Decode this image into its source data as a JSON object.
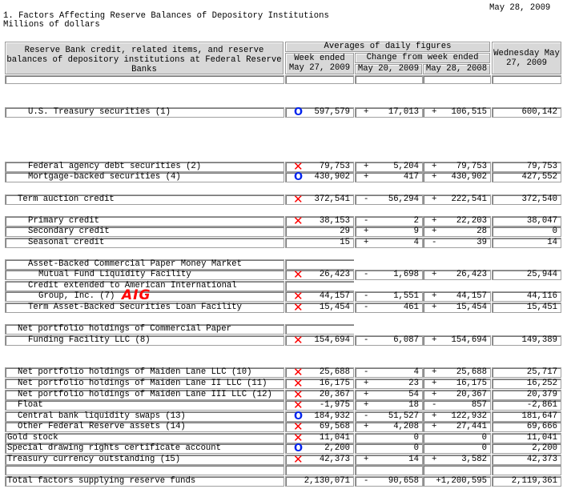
{
  "date": "May 28, 2009",
  "title": "1. Factors Affecting Reserve Balances of Depository Institutions",
  "subtitle": "Millions of dollars",
  "header": {
    "label_col": "Reserve Bank credit, related items, and\nreserve balances of depository institutions at\nFederal Reserve Banks",
    "averages": "Averages of daily figures",
    "week_ended": "Week ended\nMay 27, 2009",
    "change_from": "Change from week ended",
    "change1": "May 20, 2009",
    "change2": "May 28, 2008",
    "wednesday": "Wednesday\nMay 27, 2009"
  },
  "annotation_text": "AIG",
  "colors": {
    "x_mark": "#ff0000",
    "o_mark": "#0022ee",
    "header_bg": "#d8d8d8"
  },
  "rows": [
    {
      "label": "U.S. Treasury securities (1)",
      "indent": 2,
      "mark": "circle",
      "week": "597,579",
      "s1": "+",
      "c1": "17,013",
      "s2": "+",
      "c2": "106,515",
      "wed": "600,142"
    },
    {
      "label": "Federal agency debt securities (2)",
      "indent": 2,
      "mark": "x",
      "week": "79,753",
      "s1": "+",
      "c1": "5,204",
      "s2": "+",
      "c2": "79,753",
      "wed": "79,753"
    },
    {
      "label": "Mortgage-backed securities (4)",
      "indent": 2,
      "mark": "circle",
      "week": "430,902",
      "s1": "+",
      "c1": "417",
      "s2": "+",
      "c2": "430,902",
      "wed": "427,552"
    },
    {
      "label": "Term auction credit",
      "indent": 1,
      "mark": "x",
      "week": "372,541",
      "s1": "-",
      "c1": "56,294",
      "s2": "+",
      "c2": "222,541",
      "wed": "372,540"
    },
    {
      "label": "Primary credit",
      "indent": 2,
      "mark": "x",
      "week": "38,153",
      "s1": "-",
      "c1": "2",
      "s2": "+",
      "c2": "22,203",
      "wed": "38,047"
    },
    {
      "label": "Secondary credit",
      "indent": 2,
      "mark": "",
      "week": "29",
      "s1": "+",
      "c1": "9",
      "s2": "+",
      "c2": "28",
      "wed": "0"
    },
    {
      "label": "Seasonal credit",
      "indent": 2,
      "mark": "",
      "week": "15",
      "s1": "+",
      "c1": "4",
      "s2": "-",
      "c2": "39",
      "wed": "14"
    },
    {
      "label": "Asset-Backed Commercial Paper Money Market",
      "indent": 2,
      "labelonly": true
    },
    {
      "label": "Mutual Fund Liquidity Facility",
      "indent": 3,
      "mark": "x",
      "week": "26,423",
      "s1": "-",
      "c1": "1,698",
      "s2": "+",
      "c2": "26,423",
      "wed": "25,944"
    },
    {
      "label": "Credit extended to American International",
      "indent": 2,
      "labelonly": true
    },
    {
      "label": "Group, Inc. (7)",
      "indent": 3,
      "mark": "x",
      "week": "44,157",
      "s1": "-",
      "c1": "1,551",
      "s2": "+",
      "c2": "44,157",
      "wed": "44,116"
    },
    {
      "label": "Term Asset-Backed Securities Loan Facility",
      "indent": 2,
      "mark": "x",
      "week": "15,454",
      "s1": "-",
      "c1": "461",
      "s2": "+",
      "c2": "15,454",
      "wed": "15,451"
    },
    {
      "label": "Net portfolio holdings of Commercial Paper",
      "indent": 1,
      "labelonly": true
    },
    {
      "label": "Funding Facility LLC (8)",
      "indent": 2,
      "mark": "x",
      "week": "154,694",
      "s1": "-",
      "c1": "6,087",
      "s2": "+",
      "c2": "154,694",
      "wed": "149,389"
    },
    {
      "label": "Net portfolio holdings of Maiden Lane LLC (10)",
      "indent": 1,
      "mark": "x",
      "week": "25,688",
      "s1": "-",
      "c1": "4",
      "s2": "+",
      "c2": "25,688",
      "wed": "25,717"
    },
    {
      "label": "Net portfolio holdings of Maiden Lane II LLC (11)",
      "indent": 1,
      "mark": "x",
      "week": "16,175",
      "s1": "+",
      "c1": "23",
      "s2": "+",
      "c2": "16,175",
      "wed": "16,252"
    },
    {
      "label": "Net portfolio holdings of Maiden Lane III LLC (12)",
      "indent": 1,
      "mark": "x",
      "week": "20,367",
      "s1": "+",
      "c1": "54",
      "s2": "+",
      "c2": "20,367",
      "wed": "20,379"
    },
    {
      "label": "Float",
      "indent": 1,
      "mark": "x",
      "week": "-1,975",
      "s1": "+",
      "c1": "18",
      "s2": "-",
      "c2": "857",
      "wed": "-2,861"
    },
    {
      "label": "Central bank liquidity swaps (13)",
      "indent": 1,
      "mark": "circle",
      "week": "184,932",
      "s1": "-",
      "c1": "51,527",
      "s2": "+",
      "c2": "122,932",
      "wed": "181,647"
    },
    {
      "label": "Other Federal Reserve assets (14)",
      "indent": 1,
      "mark": "x",
      "week": "69,568",
      "s1": "+",
      "c1": "4,208",
      "s2": "+",
      "c2": "27,441",
      "wed": "69,666"
    },
    {
      "label": "Gold stock",
      "indent": 0,
      "mark": "x",
      "week": "11,041",
      "s1": "",
      "c1": "0",
      "s2": "",
      "c2": "0",
      "wed": "11,041"
    },
    {
      "label": "Special drawing rights certificate account",
      "indent": 0,
      "mark": "circle",
      "week": "2,200",
      "s1": "",
      "c1": "0",
      "s2": "",
      "c2": "0",
      "wed": "2,200"
    },
    {
      "label": "Treasury currency outstanding (15)",
      "indent": 0,
      "mark": "x",
      "week": "42,373",
      "s1": "+",
      "c1": "14",
      "s2": "+",
      "c2": "3,582",
      "wed": "42,373"
    },
    {
      "label": "",
      "indent": 0,
      "mark": "",
      "week": "",
      "s1": "",
      "c1": "",
      "s2": "",
      "c2": "",
      "wed": ""
    },
    {
      "label": "Total factors supplying reserve funds",
      "indent": 0,
      "mark": "",
      "week": "2,130,071",
      "s1": "-",
      "c1": "90,658",
      "s2": "",
      "c2": "+1,200,595",
      "wed": "2,119,361"
    }
  ]
}
